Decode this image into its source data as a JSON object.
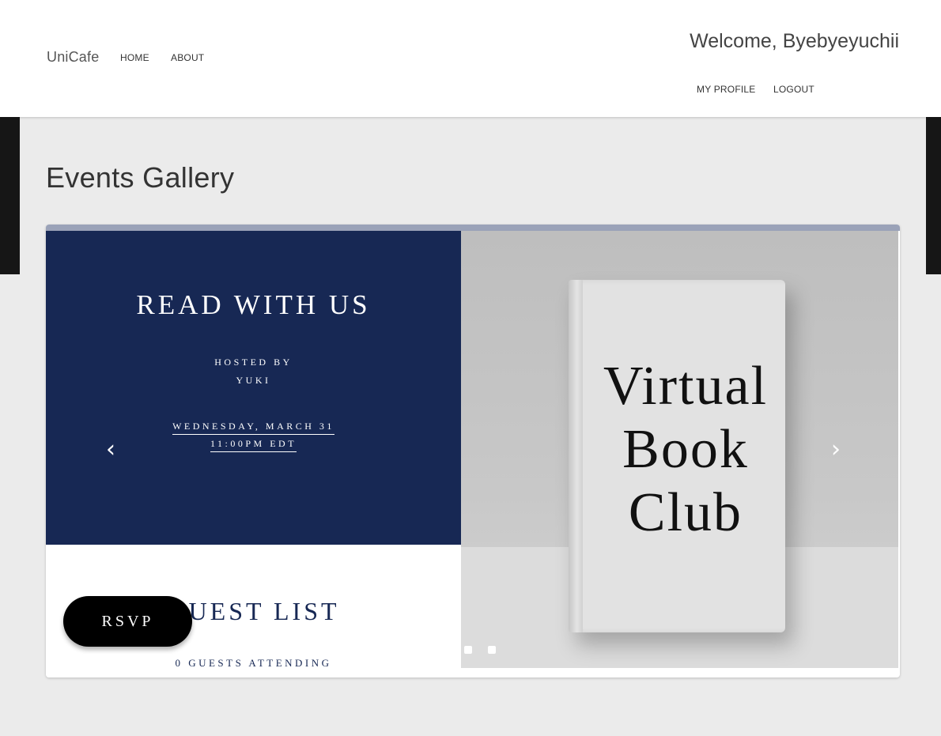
{
  "header": {
    "brand": "UniCafe",
    "nav": [
      "HOME",
      "ABOUT"
    ],
    "welcome": "Welcome, Byebyeyuchii",
    "user_links": [
      "MY PROFILE",
      "LOGOUT"
    ]
  },
  "page": {
    "title": "Events Gallery"
  },
  "carousel": {
    "active_index": 0,
    "slide_count": 3,
    "slide": {
      "event_title": "READ WITH US",
      "hosted_by_label": "HOSTED BY",
      "host": "YUKI",
      "date": "WEDNESDAY, MARCH 31",
      "time": "11:00PM EDT",
      "guest_list_title": "GUEST LIST",
      "guest_count": "0 GUESTS ATTENDING",
      "rsvp_label": "RSVP",
      "image_text": [
        "Virtual",
        "Book",
        "Club"
      ]
    },
    "prev_icon": "chevron-left-icon",
    "next_icon": "chevron-right-icon"
  },
  "colors": {
    "event_panel": "#172854",
    "rsvp_button": "#000000",
    "header_bg": "#ffffff",
    "page_bg": "#ebebeb"
  }
}
